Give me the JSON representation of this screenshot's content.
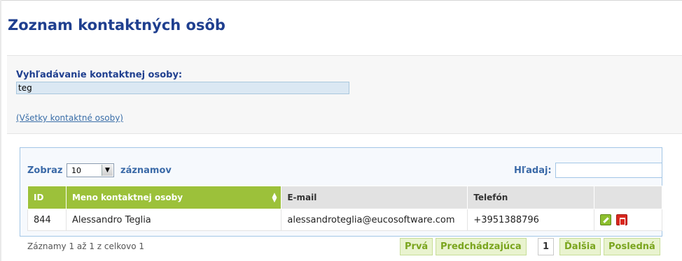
{
  "page": {
    "title": "Zoznam kontaktných osôb"
  },
  "search": {
    "label": "Vyhľadávanie kontaktnej osoby:",
    "value": "teg",
    "all_link": "(Všetky kontaktné osoby)"
  },
  "table_controls": {
    "show_label": "Zobraz",
    "page_size": "10",
    "records_label": "záznamov",
    "filter_label": "Hľadaj:",
    "filter_value": ""
  },
  "table": {
    "columns": [
      "ID",
      "Meno kontaktnej osoby",
      "E-mail",
      "Telefón",
      ""
    ],
    "rows": [
      {
        "id": "844",
        "name": "Alessandro Teglia",
        "email": "alessandroteglia@eucosoftware.com",
        "phone": "+3951388796"
      }
    ]
  },
  "footer": {
    "info": "Záznamy 1 až 1 z celkovo 1",
    "pager": {
      "first": "Prvá",
      "prev": "Predchádzajúca",
      "current": "1",
      "next": "Ďalšia",
      "last": "Posledná"
    }
  },
  "icons": {
    "edit": "pencil-icon",
    "delete": "trash-icon",
    "sort": "sort-icon",
    "dropdown": "chevron-down-icon"
  },
  "colors": {
    "title": "#1f3f8f",
    "accent_green": "#9cc13a",
    "link": "#3a6ea8"
  }
}
